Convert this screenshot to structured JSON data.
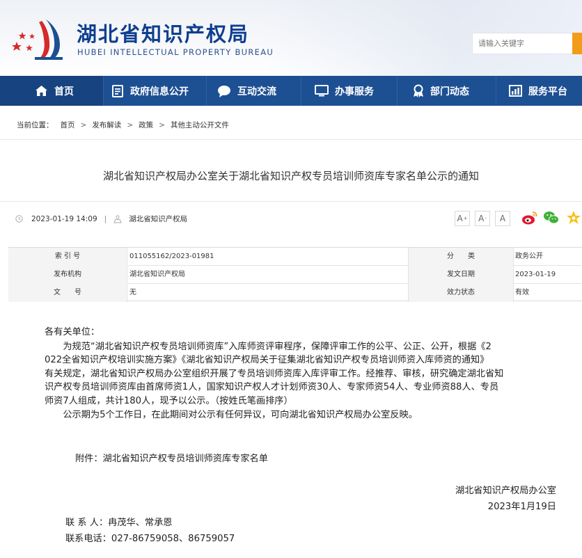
{
  "header": {
    "site_title": "湖北省知识产权局",
    "site_subtitle": "HUBEI INTELLECTUAL PROPERTY BUREAU",
    "search_placeholder": "请输入关键字"
  },
  "nav": {
    "items": [
      {
        "label": "首页",
        "icon": "home-icon"
      },
      {
        "label": "政府信息公开",
        "icon": "document-icon"
      },
      {
        "label": "互动交流",
        "icon": "chat-icon"
      },
      {
        "label": "办事服务",
        "icon": "monitor-icon"
      },
      {
        "label": "部门动态",
        "icon": "badge-icon"
      },
      {
        "label": "服务平台",
        "icon": "chart-icon"
      }
    ]
  },
  "breadcrumb": {
    "prefix": "当前位置：",
    "items": [
      "首页",
      "发布解读",
      "政策",
      "其他主动公开文件"
    ]
  },
  "article": {
    "title": "湖北省知识产权局办公室关于湖北省知识产权专员培训师资库专家名单公示的通知",
    "datetime": "2023-01-19 14:09",
    "source": "湖北省知识产权局"
  },
  "font_size_buttons": [
    "A",
    "A",
    "A"
  ],
  "info_table": {
    "rows": [
      {
        "l1": "索 引 号",
        "v1": "011055162/2023-01981",
        "l2": "分　　类",
        "v2": "政务公开"
      },
      {
        "l1": "发布机构",
        "v1": "湖北省知识产权局",
        "l2": "发文日期",
        "v2": "2023-01-19"
      },
      {
        "l1": "文　　号",
        "v1": "无",
        "l2": "效力状态",
        "v2": "有效"
      }
    ]
  },
  "body": {
    "greeting": "各有关单位：",
    "lines": [
      "　　为规范“湖北省知识产权专员培训师资库”入库师资评审程序，保障评审工作的公平、公正、公开，根据《2",
      "022全省知识产权培训实施方案》《湖北省知识产权局关于征集湖北省知识产权专员培训师资入库师资的通知》",
      "有关规定，湖北省知识产权局办公室组织开展了专员培训师资库入库评审工作。经推荐、审核，研究确定湖北省知",
      "识产权专员培训师资库由首席师资1人，国家知识产权人才计划师资30人、专家师资54人、专业师资88人、专员",
      "师资7人组成，共计180人，现予以公示。（按姓氏笔画排序）",
      "　　公示期为5个工作日，在此期间对公示有任何异议，可向湖北省知识产权局办公室反映。"
    ],
    "attachment": "附件：湖北省知识产权专员培训师资库专家名单",
    "signature_org": "湖北省知识产权局办公室",
    "signature_date": "2023年1月19日",
    "contact": "联 系 人：冉茂华、常承恩",
    "phone": "联系电话：027-86759058、86759057"
  },
  "colors": {
    "nav_bg": "#1d4f93",
    "nav_active": "#174380",
    "title_blue": "#0e3f8f",
    "search_button": "#f39b1b",
    "logo_red": "#d62a2a"
  }
}
